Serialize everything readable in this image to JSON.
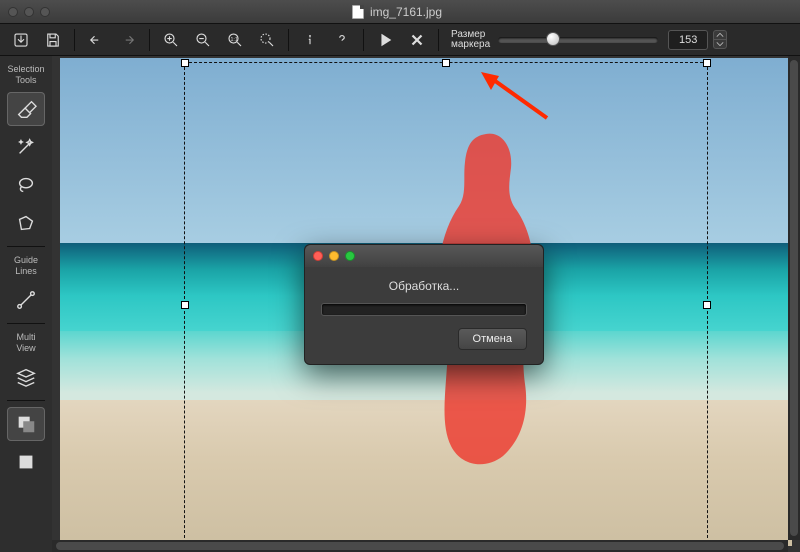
{
  "titlebar": {
    "filename": "img_7161.jpg"
  },
  "toolbar": {
    "marker_label_line1": "Размер",
    "marker_label_line2": "маркера",
    "marker_value": "153",
    "slider_percent": 30
  },
  "sidebar": {
    "selection_label_line1": "Selection",
    "selection_label_line2": "Tools",
    "guide_label_line1": "Guide",
    "guide_label_line2": "Lines",
    "multi_label_line1": "Multi",
    "multi_label_line2": "View"
  },
  "dialog": {
    "title": "Обработка...",
    "cancel": "Отмена"
  },
  "colors": {
    "mask": "#ed3b2f",
    "arrow": "#ff2a00"
  }
}
